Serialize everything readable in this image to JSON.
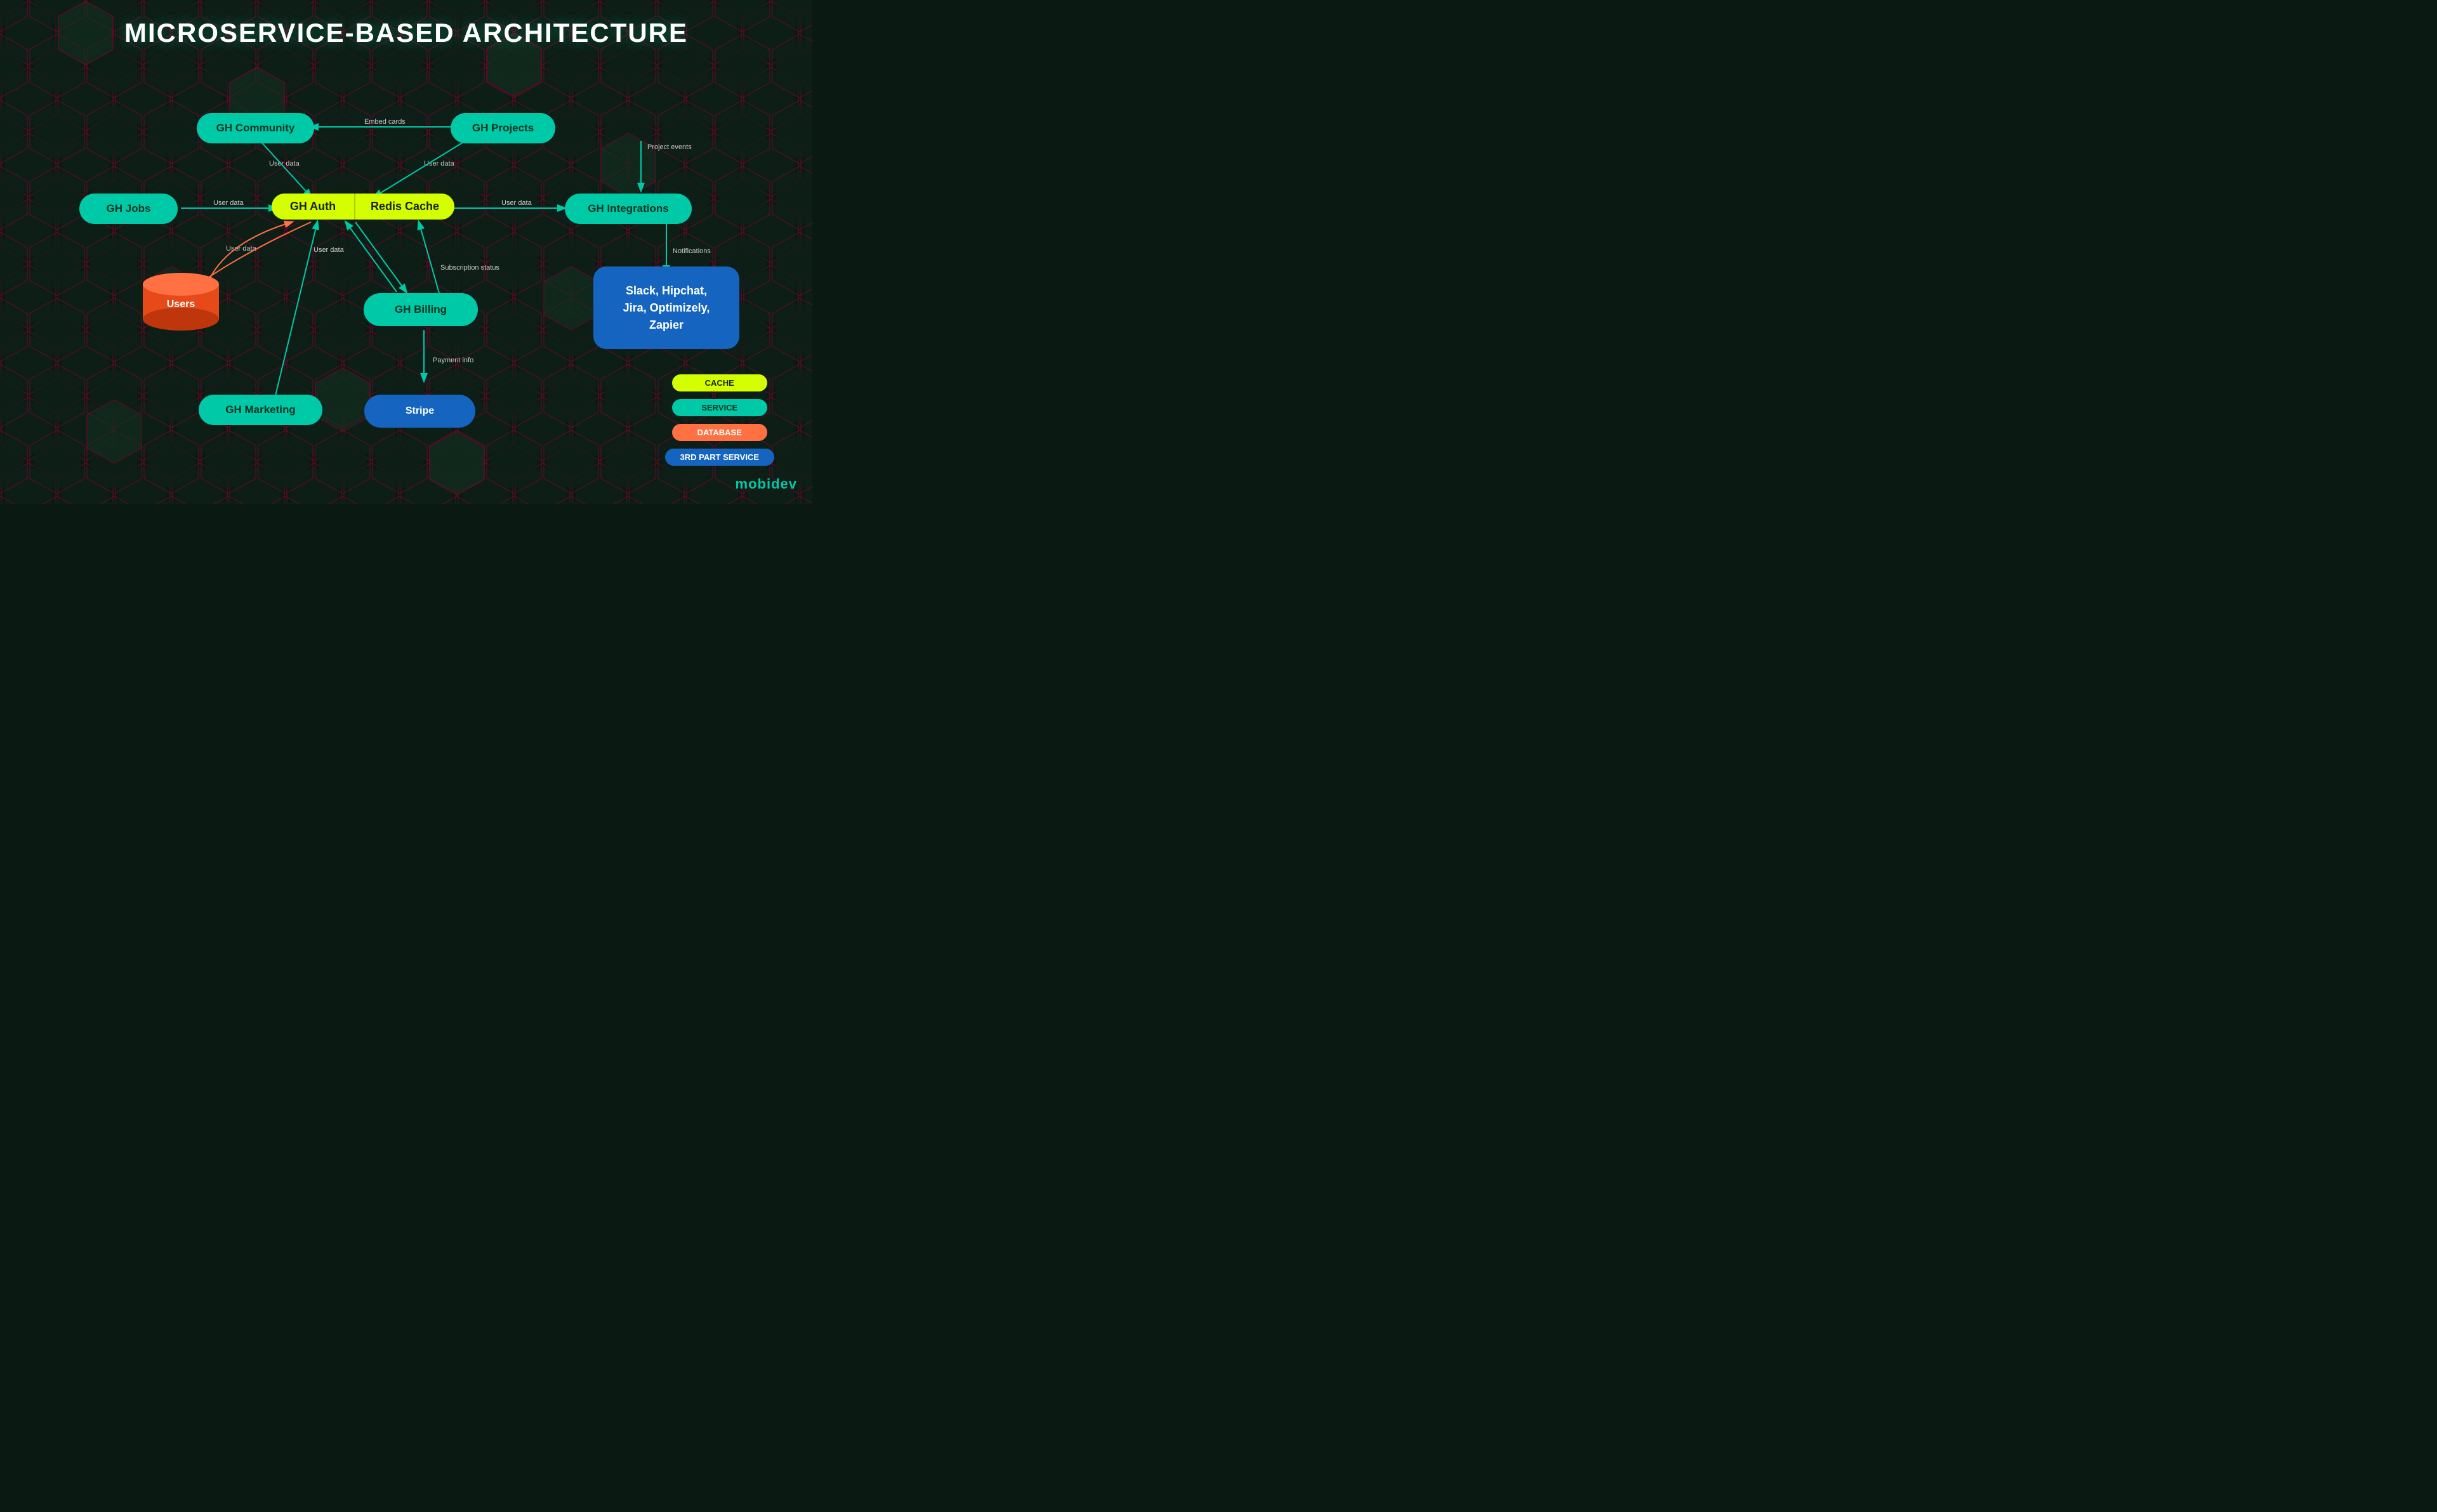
{
  "title": "MICROSERVICE-BASED ARCHITECTURE",
  "nodes": {
    "gh_community": {
      "label": "GH Community",
      "type": "service"
    },
    "gh_projects": {
      "label": "GH Projects",
      "type": "service"
    },
    "gh_auth": {
      "label": "GH Auth",
      "type": "cache"
    },
    "redis_cache": {
      "label": "Redis Cache",
      "type": "cache"
    },
    "gh_jobs": {
      "label": "GH Jobs",
      "type": "service"
    },
    "gh_integrations": {
      "label": "GH Integrations",
      "type": "service"
    },
    "users": {
      "label": "Users",
      "type": "database"
    },
    "gh_billing": {
      "label": "GH Billing",
      "type": "service"
    },
    "integrations_3rd": {
      "label": "Slack, Hipchat,\nJira, Optimizely,\nZapier",
      "type": "3rd"
    },
    "gh_marketing": {
      "label": "GH Marketing",
      "type": "service"
    },
    "stripe": {
      "label": "Stripe",
      "type": "3rd_blue"
    }
  },
  "arrow_labels": {
    "embed_cards": "Embed\ncards",
    "user_data_community": "User\ndata",
    "user_data_projects": "User\ndata",
    "user_data_jobs": "User\ndata",
    "user_data_jobs2": "User\ndata",
    "user_data_billing": "User\ndata",
    "user_data_billing2": "User\ndata",
    "subscription_status": "Subscription\nstatus",
    "project_events": "Project\nevents",
    "notifications": "Notifications",
    "payment_info": "Payment\ninfo"
  },
  "legend": {
    "items": [
      {
        "label": "CACHE",
        "type": "cache"
      },
      {
        "label": "SERVICE",
        "type": "service"
      },
      {
        "label": "DATABASE",
        "type": "database"
      },
      {
        "label": "3RD PART SERVICE",
        "type": "3rd"
      }
    ]
  },
  "logo": {
    "text_white": "mobi",
    "text_accent": "dev"
  }
}
